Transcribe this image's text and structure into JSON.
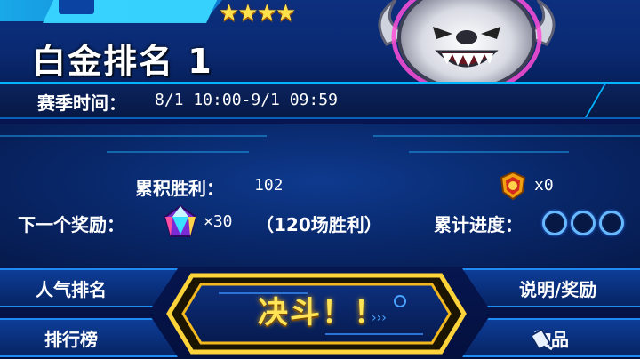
{
  "banner": {
    "stars": "★★★★",
    "rank_title": "白金排名 1"
  },
  "season": {
    "label": "赛季时间：",
    "range": "8/1 10:00-9/1 09:59"
  },
  "stats": {
    "wins_label": "累积胜利：",
    "wins_value": "102",
    "medal_count": "x0",
    "next_reward_label": "下一个奖励：",
    "reward_quantity": "×30",
    "reward_condition": "（120场胜利）",
    "progress_label": "累计进度：",
    "progress_rings": 3
  },
  "buttons": {
    "popularity": "人气排名",
    "leaderboard": "排行榜",
    "duel": "决斗！！",
    "rules": "说明/奖励",
    "items": "物品"
  },
  "colors": {
    "accent_cyan": "#00b4ff",
    "duel_gold": "#ffd43b",
    "panel_blue": "#082565"
  }
}
